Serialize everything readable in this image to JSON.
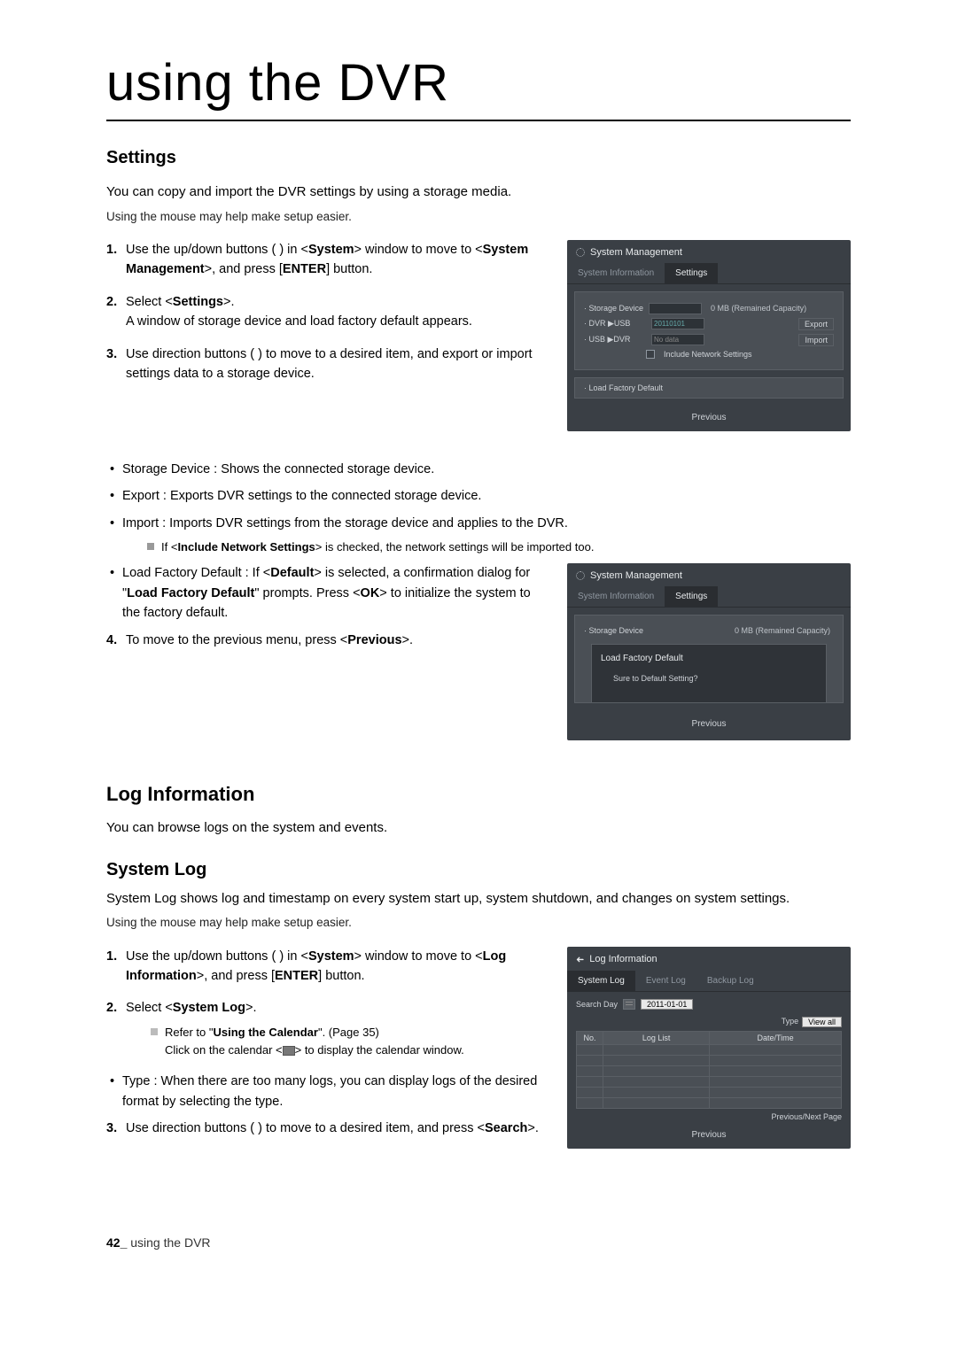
{
  "page": {
    "title": "using the DVR",
    "footer_number": "42_",
    "footer_text": "using the DVR"
  },
  "settings": {
    "heading": "Settings",
    "intro": "You can copy and import the DVR settings by using a storage media.",
    "mouse_note": "Using the mouse may help make setup easier.",
    "steps": {
      "s1_a": "Use the up/down buttons (",
      "s1_b": ") in <",
      "s1_system": "System",
      "s1_c": "> window to move to <",
      "s1_sysmgmt": "System Management",
      "s1_d": ">, and press [",
      "s1_enter": "ENTER",
      "s1_e": "] button.",
      "s2_a": "Select <",
      "s2_set": "Settings",
      "s2_b": ">.",
      "s2_desc": "A window of storage device and load factory default appears.",
      "s3_a": "Use direction buttons (",
      "s3_b": ") to move to a desired item, and export or import settings data to a storage device."
    },
    "bullets": {
      "b1": "Storage Device : Shows the connected storage device.",
      "b2": "Export : Exports DVR settings to the connected storage device.",
      "b3": "Import : Imports DVR settings from the storage device and applies to the DVR.",
      "b3_note_a": "If <",
      "b3_note_bold": "Include Network Settings",
      "b3_note_b": "> is checked, the network settings will be imported too.",
      "b4_a": "Load Factory Default : If <",
      "b4_default": "Default",
      "b4_b": "> is selected, a confirmation dialog for \"",
      "b4_lfd": "Load Factory Default",
      "b4_c": "\" prompts. Press <",
      "b4_ok": "OK",
      "b4_d": "> to initialize the system to the factory default."
    },
    "step4_a": "To move to the previous menu, press <",
    "step4_prev": "Previous",
    "step4_b": ">."
  },
  "ui1": {
    "title": "System Management",
    "tab1": "System Information",
    "tab2": "Settings",
    "storage_device": "· Storage Device",
    "capacity": "0 MB (Remained Capacity)",
    "dvr_usb": "· DVR ▶USB",
    "date_val": "20110101",
    "export": "Export",
    "usb_dvr": "· USB ▶DVR",
    "no_data": "No data",
    "import": "Import",
    "include": "Include Network Settings",
    "lfd": "· Load Factory Default",
    "previous": "Previous"
  },
  "ui2": {
    "modal_title": "Load Factory Default",
    "modal_text": "Sure to Default Setting?"
  },
  "loginfo": {
    "heading": "Log Information",
    "intro": "You can browse logs on the system and events.",
    "syslog_heading": "System Log",
    "syslog_intro": "System Log shows log and timestamp on every system start up, system shutdown, and changes on system settings.",
    "mouse_note": "Using the mouse may help make setup easier.",
    "s1_a": "Use the up/down buttons (",
    "s1_b": ") in <",
    "s1_system": "System",
    "s1_c": "> window to move to <",
    "s1_loginfo": "Log Information",
    "s1_d": ">, and press [",
    "s1_enter": "ENTER",
    "s1_e": "] button.",
    "s2_a": "Select <",
    "s2_syslog": "System Log",
    "s2_b": ">.",
    "s2_note_a": "Refer to \"",
    "s2_note_bold": "Using the Calendar",
    "s2_note_b": "\". (Page 35)",
    "s2_note_c": "Click on the calendar <",
    "s2_note_d": "> to display the calendar window.",
    "type_bullet": "Type : When there are too many logs, you can display logs of the desired format by selecting the type.",
    "s3_a": "Use direction buttons (",
    "s3_b": ") to move to a desired item, and press <",
    "s3_search": "Search",
    "s3_c": ">."
  },
  "ui3": {
    "title": "Log Information",
    "tab1": "System Log",
    "tab2": "Event Log",
    "tab3": "Backup Log",
    "search_day": "Search Day",
    "date": "2011-01-01",
    "type_lbl": "Type",
    "viewall": "View all",
    "col_no": "No.",
    "col_loglist": "Log List",
    "col_dt": "Date/Time",
    "pager": "Previous/Next Page",
    "previous": "Previous"
  }
}
